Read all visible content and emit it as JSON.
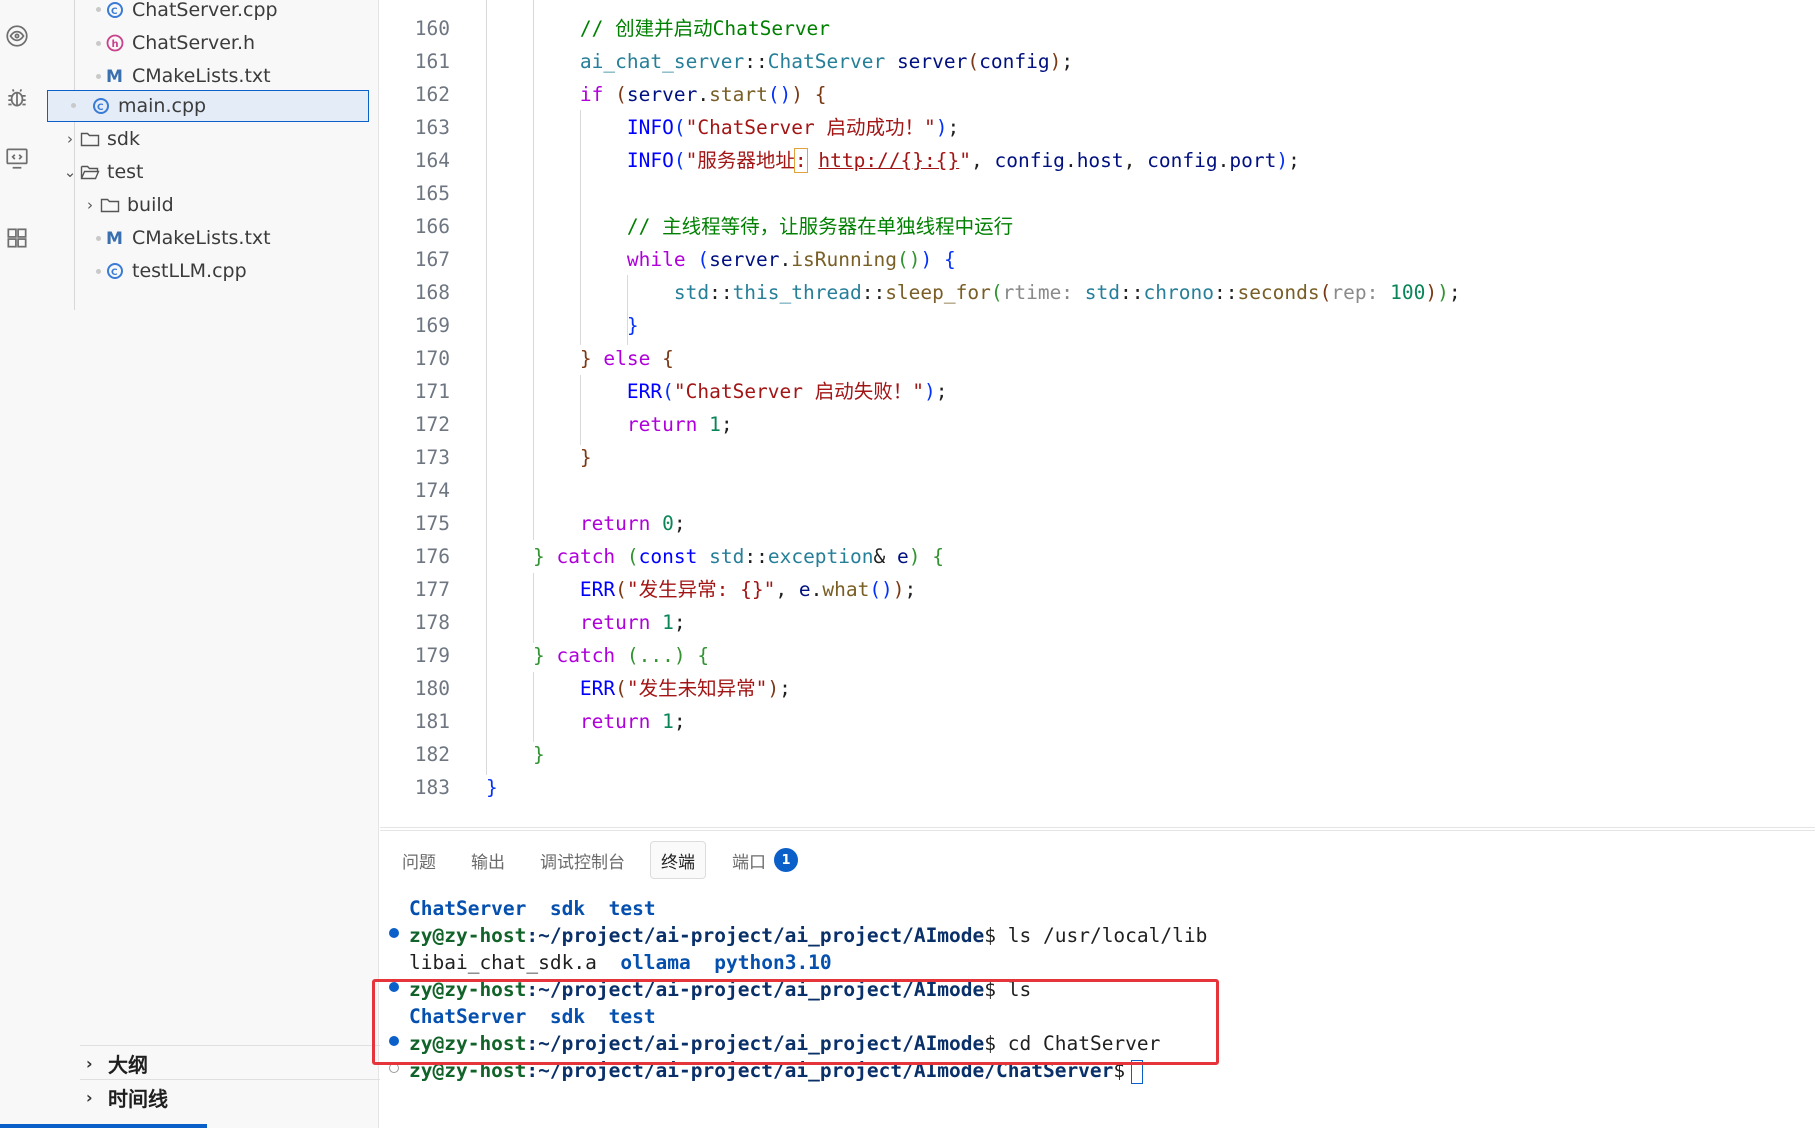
{
  "activity_bar": {
    "icons": [
      "eye-icon",
      "debug-icon",
      "remote-icon",
      "extensions-icon"
    ]
  },
  "explorer": {
    "items": [
      {
        "label": "ChatServer.cpp",
        "icon": "cpp-file-icon"
      },
      {
        "label": "ChatServer.h",
        "icon": "header-file-icon"
      },
      {
        "label": "CMakeLists.txt",
        "icon": "cmake-file-icon"
      },
      {
        "label": "main.cpp",
        "icon": "cpp-file-icon",
        "selected": true
      },
      {
        "label": "sdk",
        "icon": "folder-icon",
        "expanded": false
      },
      {
        "label": "test",
        "icon": "folder-open-icon",
        "expanded": true
      },
      {
        "label": "build",
        "icon": "folder-icon",
        "expanded": false
      },
      {
        "label": "CMakeLists.txt",
        "icon": "cmake-file-icon"
      },
      {
        "label": "testLLM.cpp",
        "icon": "cpp-file-icon"
      }
    ],
    "outline_label": "大纲",
    "timeline_label": "时间线"
  },
  "editor": {
    "line_numbers": [
      "160",
      "161",
      "162",
      "163",
      "164",
      "165",
      "166",
      "167",
      "168",
      "169",
      "170",
      "171",
      "172",
      "173",
      "174",
      "175",
      "176",
      "177",
      "178",
      "179",
      "180",
      "181",
      "182",
      "183"
    ]
  },
  "panel": {
    "tabs": [
      {
        "label": "问题"
      },
      {
        "label": "输出"
      },
      {
        "label": "调试控制台"
      },
      {
        "label": "终端",
        "active": true
      },
      {
        "label": "端口",
        "badge": "1"
      }
    ],
    "terminal": {
      "prompt_user": "zy@zy-host",
      "prompt_path": ":~/project/ai-project/ai_project/AImode",
      "prompt_path_cs": ":~/project/ai-project/ai_project/AImode/ChatServer",
      "prompt_symbol": "$",
      "ls_output_1": [
        "ChatServer",
        "sdk",
        "test"
      ],
      "cmd_1": " ls /usr/local/lib",
      "lib_output": {
        "file": "libai_chat_sdk.a",
        "dirs": [
          "ollama",
          "python3.10"
        ]
      },
      "cmd_2": " ls",
      "cmd_3": " cd ChatServer"
    },
    "highlight_color": "#e5353b"
  }
}
